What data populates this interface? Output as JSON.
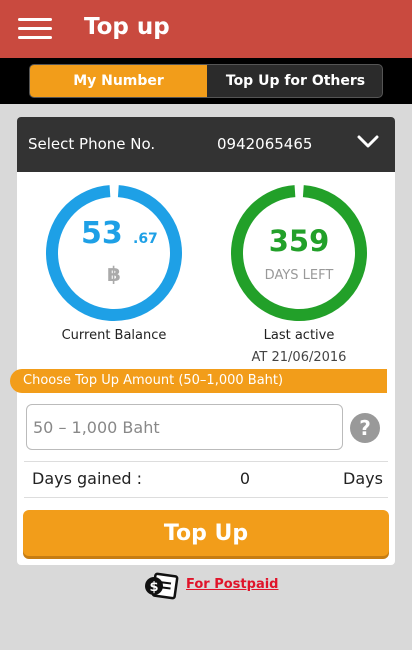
{
  "header": {
    "title": "Top up",
    "menu_icon": "hamburger-menu-icon"
  },
  "tabs": [
    {
      "label": "My Number",
      "active": true
    },
    {
      "label": "Top Up for Others",
      "active": false
    }
  ],
  "phone": {
    "label": "Select Phone No.",
    "number": "0942065465",
    "icon": "chevron-down-icon"
  },
  "balance": {
    "integer": "53",
    "decimal": ".67",
    "currency": "฿",
    "caption": "Current Balance",
    "color": "#1ea0e6"
  },
  "days": {
    "value": "359",
    "unit": "DAYS LEFT",
    "caption": "Last active",
    "date": "AT 21/06/2016",
    "color": "#22a029"
  },
  "amount": {
    "banner": "Choose Top Up Amount (50–1,000 Baht)",
    "placeholder": "50 – 1,000 Baht",
    "help_icon": "help-icon"
  },
  "days_gained": {
    "label": "Days gained :",
    "value": "0",
    "unit": "Days"
  },
  "button": {
    "label": "Top Up"
  },
  "postpaid": {
    "label": "For Postpaid",
    "icon": "bill-money-icon"
  },
  "colors": {
    "appbar": "#c94a3f",
    "accent": "#f29d1a",
    "link": "#e0142a"
  }
}
